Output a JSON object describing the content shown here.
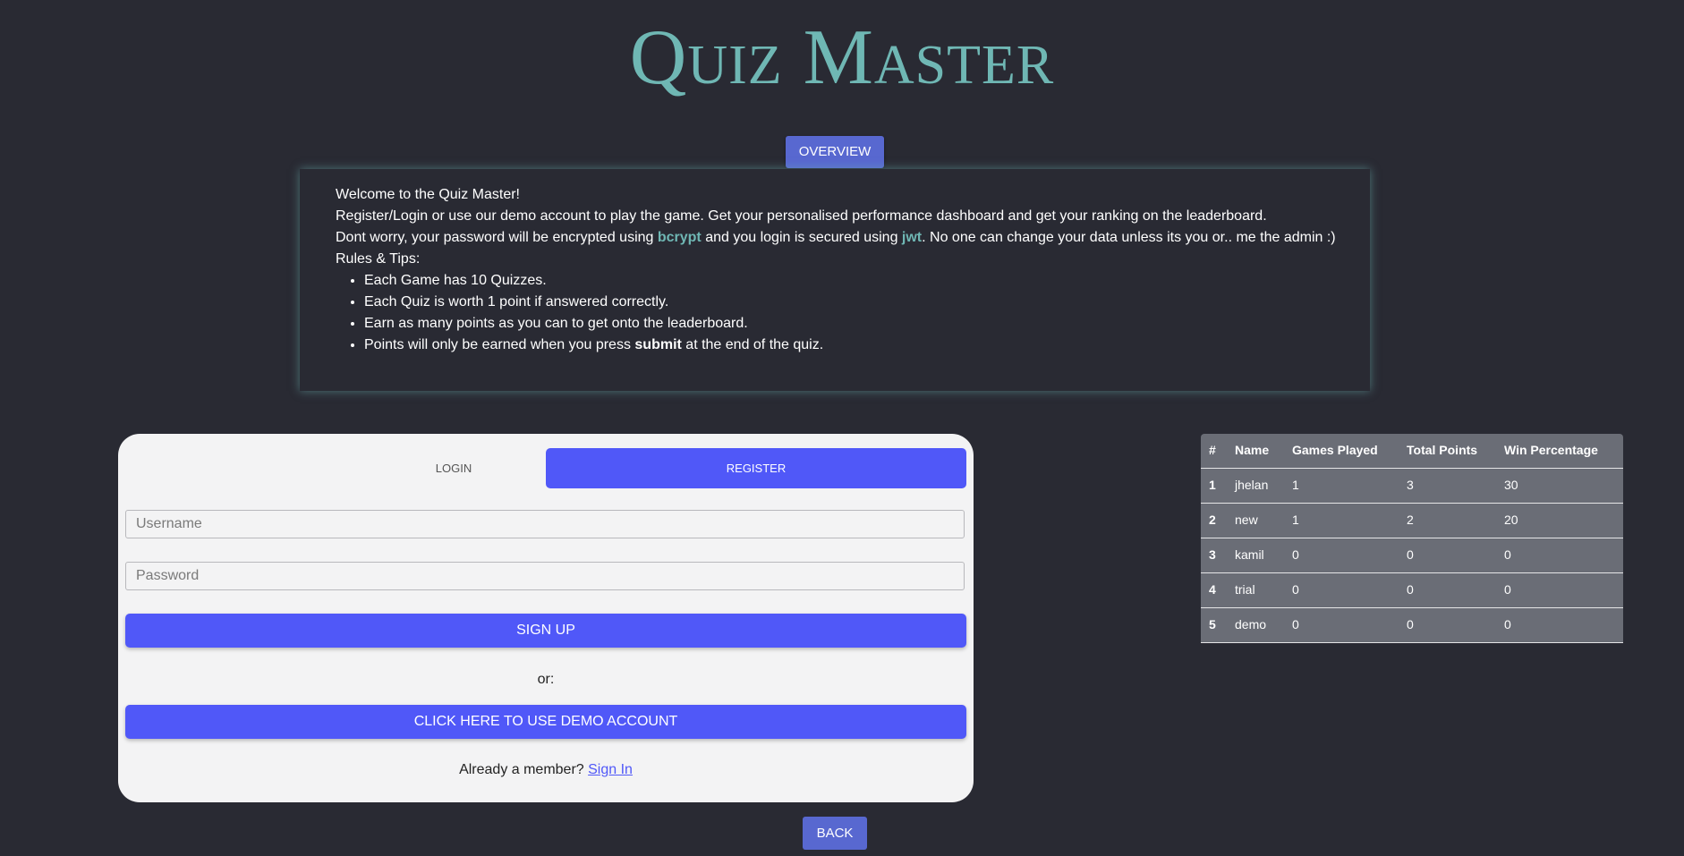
{
  "app": {
    "title": "Quiz Master"
  },
  "overview": {
    "button_label": "OVERVIEW",
    "welcome": "Welcome to the Quiz Master!",
    "intro": "Register/Login or use our demo account to play the game. Get your personalised performance dashboard and get your ranking on the leaderboard.",
    "security_prefix": "Dont worry, your password will be encrypted using ",
    "security_bcrypt": "bcrypt",
    "security_mid": " and you login is secured using ",
    "security_jwt": "jwt",
    "security_suffix": ". No one can change your data unless its you or.. me the admin :)",
    "rules_heading": "Rules & Tips:",
    "rules": [
      "Each Game has 10 Quizzes.",
      "Each Quiz is worth 1 point if answered correctly.",
      "Earn as many points as you can to get onto the leaderboard."
    ],
    "rule4_prefix": "Points will only be earned when you press ",
    "rule4_bold": "submit",
    "rule4_suffix": " at the end of the quiz."
  },
  "auth": {
    "tab_login": "LOGIN",
    "tab_register": "REGISTER",
    "active_tab": "REGISTER",
    "username_placeholder": "Username",
    "password_placeholder": "Password",
    "signup_label": "SIGN UP",
    "or_text": "or:",
    "demo_label": "CLICK HERE TO USE DEMO ACCOUNT",
    "member_text": "Already a member? ",
    "signin_link": "Sign In"
  },
  "leaderboard": {
    "headers": [
      "#",
      "Name",
      "Games Played",
      "Total Points",
      "Win Percentage"
    ],
    "rows": [
      [
        "1",
        "jhelan",
        "1",
        "3",
        "30"
      ],
      [
        "2",
        "new",
        "1",
        "2",
        "20"
      ],
      [
        "3",
        "kamil",
        "0",
        "0",
        "0"
      ],
      [
        "4",
        "trial",
        "0",
        "0",
        "0"
      ],
      [
        "5",
        "demo",
        "0",
        "0",
        "0"
      ]
    ]
  },
  "nav": {
    "back_label": "BACK"
  },
  "colors": {
    "background": "#292a33",
    "accent_teal": "#6fb7b4",
    "primary_blue": "#5058f8",
    "button_blue": "#5868d0",
    "card_bg": "#f3f3f4",
    "table_bg": "#6a6d76"
  }
}
